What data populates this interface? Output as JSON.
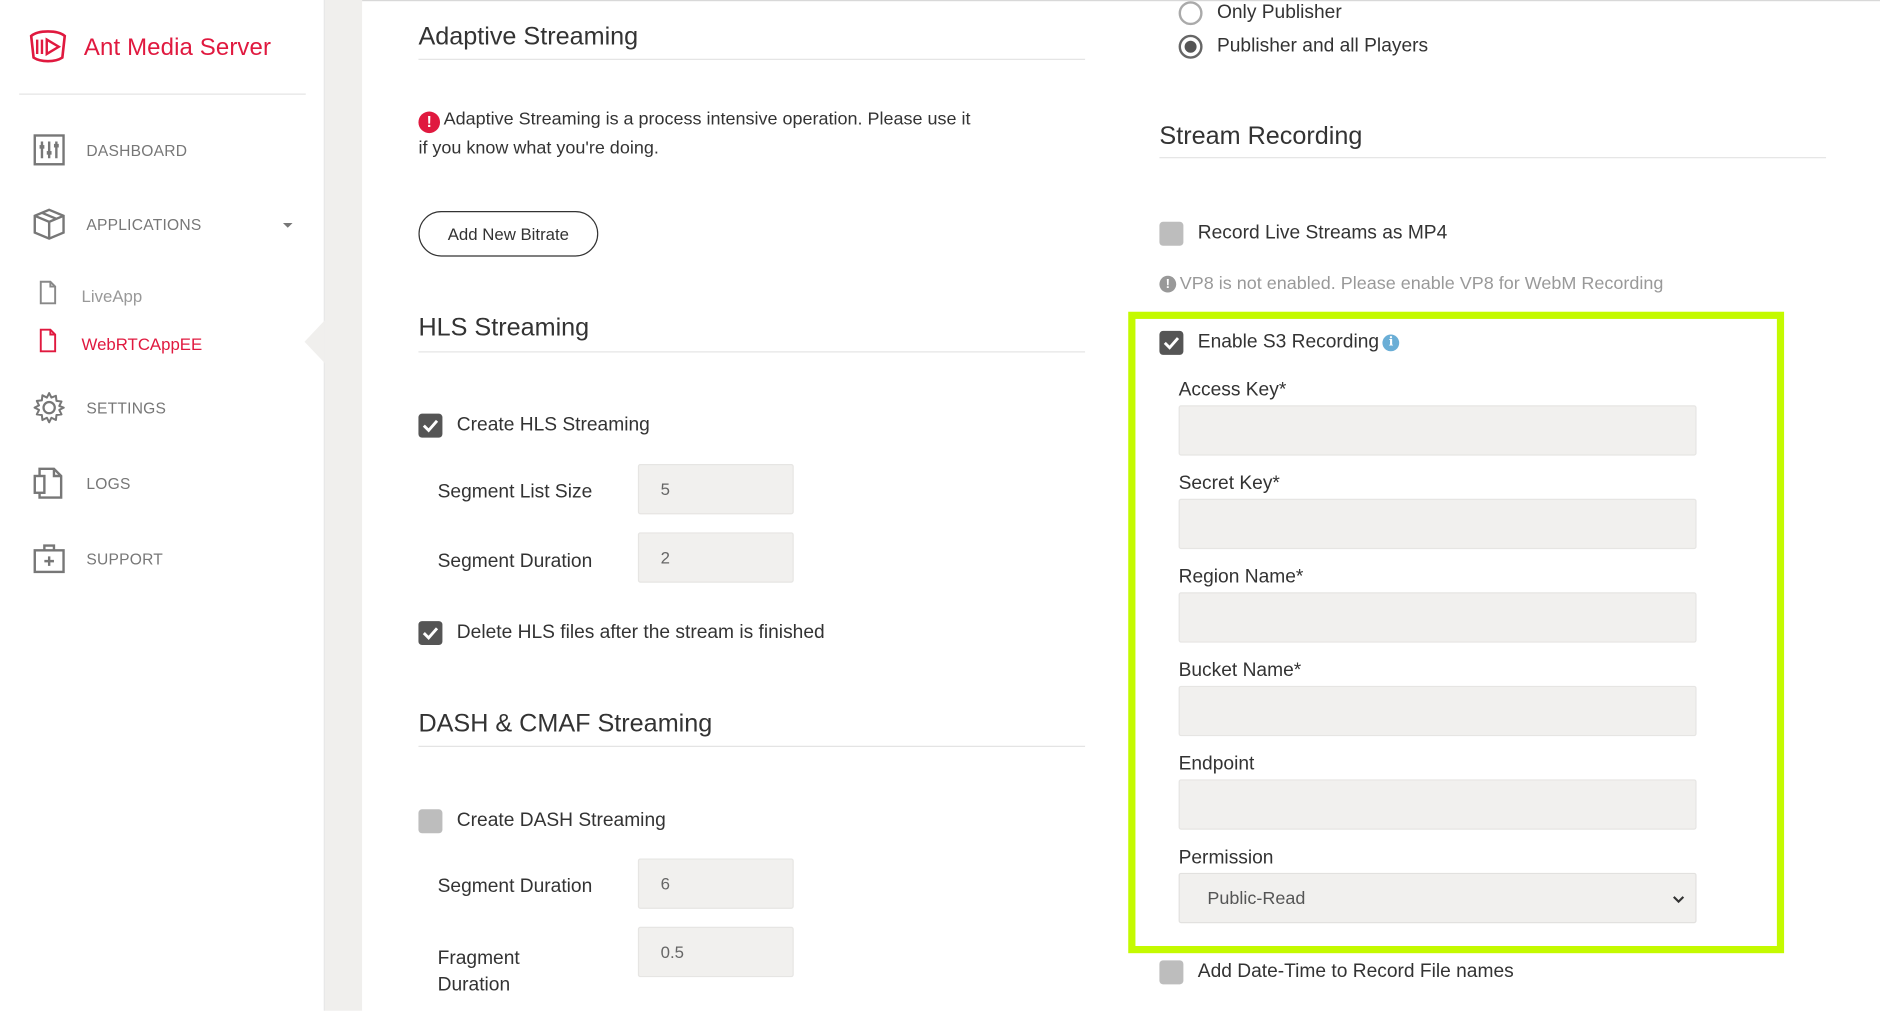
{
  "brand": {
    "name": "Ant Media Server",
    "color": "#e0193f"
  },
  "nav": {
    "dashboard": "DASHBOARD",
    "applications": "APPLICATIONS",
    "apps": [
      {
        "label": "LiveApp",
        "active": false
      },
      {
        "label": "WebRTCAppEE",
        "active": true
      }
    ],
    "settings": "SETTINGS",
    "logs": "LOGS",
    "support": "SUPPORT"
  },
  "adaptive": {
    "title": "Adaptive Streaming",
    "warning": "Adaptive Streaming is a process intensive operation. Please use it if you know what you're doing.",
    "add_button": "Add New Bitrate"
  },
  "hls": {
    "title": "HLS Streaming",
    "create_label": "Create HLS Streaming",
    "create_checked": true,
    "segment_list_size_label": "Segment List Size",
    "segment_list_size": "5",
    "segment_duration_label": "Segment Duration",
    "segment_duration": "2",
    "delete_label": "Delete HLS files after the stream is finished",
    "delete_checked": true
  },
  "dash": {
    "title": "DASH & CMAF Streaming",
    "create_label": "Create DASH Streaming",
    "create_checked": false,
    "segment_duration_label": "Segment Duration",
    "segment_duration": "6",
    "fragment_duration_label_1": "Fragment",
    "fragment_duration_label_2": "Duration",
    "fragment_duration": "0.5"
  },
  "player_options": {
    "only_publisher": "Only Publisher",
    "publisher_and_players": "Publisher and all Players",
    "selected": "publisher_and_players"
  },
  "recording": {
    "title": "Stream Recording",
    "mp4_label": "Record Live Streams as MP4",
    "mp4_checked": false,
    "vp8_note": "VP8 is not enabled. Please enable VP8 for WebM Recording",
    "s3_label": "Enable S3 Recording",
    "s3_checked": true,
    "access_key_label": "Access Key*",
    "secret_key_label": "Secret Key*",
    "region_label": "Region Name*",
    "bucket_label": "Bucket Name*",
    "endpoint_label": "Endpoint",
    "permission_label": "Permission",
    "permission_value": "Public-Read",
    "datetime_label": "Add Date-Time to Record File names",
    "datetime_checked": false
  },
  "colors": {
    "highlight": "#c4fa00",
    "accent": "#e0193f"
  }
}
